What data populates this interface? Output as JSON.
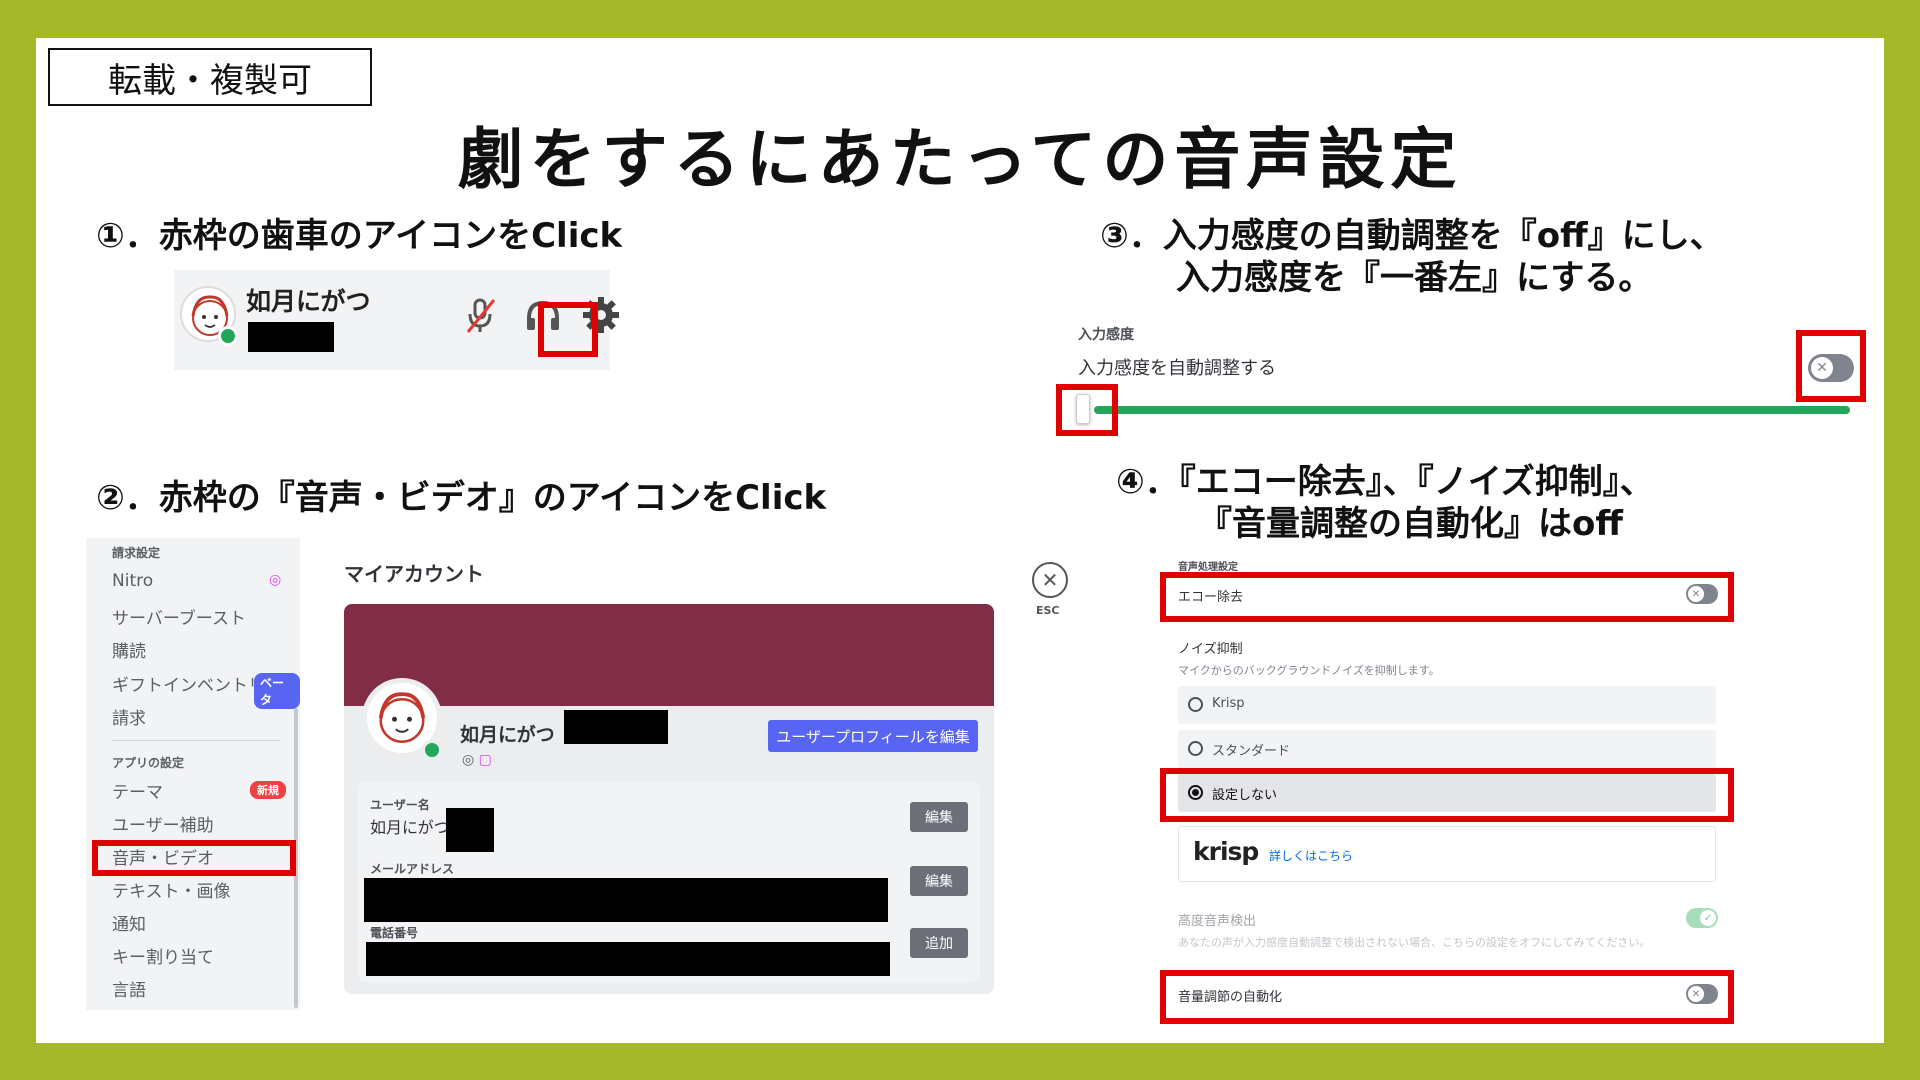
{
  "tag": "転載・複製可",
  "title": "劇をするにあたっての音声設定",
  "step1": {
    "text": "①．赤枠の歯車のアイコンをClick",
    "username": "如月にがつ"
  },
  "step2": {
    "text": "②．赤枠の『音声・ビデオ』のアイコンをClick",
    "sidebar": {
      "section1": "請求設定",
      "items1": [
        "Nitro",
        "サーバーブースト",
        "購読",
        "ギフトインベントリ",
        "請求"
      ],
      "beta": "ベータ",
      "section2": "アプリの設定",
      "items2": [
        "テーマ",
        "ユーザー補助",
        "音声・ビデオ",
        "テキスト・画像",
        "通知",
        "キー割り当て",
        "言語"
      ],
      "new_badge": "新規"
    },
    "account": {
      "heading": "マイアカウント",
      "esc": "ESC",
      "display_name": "如月にがつ",
      "edit_profile": "ユーザープロフィールを編集",
      "username_label": "ユーザー名",
      "username_value": "如月にがつ",
      "email_label": "メールアドレス",
      "phone_label": "電話番号",
      "edit": "編集",
      "add": "追加"
    }
  },
  "step3": {
    "line1": "③．入力感度の自動調整を『off』にし、",
    "line2": "入力感度を『一番左』にする。",
    "section": "入力感度",
    "label": "入力感度を自動調整する",
    "slider_value": 0
  },
  "step4": {
    "line1": "④．『エコー除去』、『ノイズ抑制』、",
    "line2": "『音量調整の自動化』はoff",
    "section": "音声処理設定",
    "echo": "エコー除去",
    "noise_title": "ノイズ抑制",
    "noise_desc": "マイクからのバックグラウンドノイズを抑制します。",
    "options": [
      "Krisp",
      "スタンダード",
      "設定しない"
    ],
    "selected": "設定しない",
    "krisp_logo": "krisp",
    "krisp_link": "詳しくはこちら",
    "advanced": "高度音声検出",
    "advanced_desc": "あなたの声が入力感度自動調整で検出されない場合、こちらの設定をオフにしてみてください。",
    "auto_gain": "音量調節の自動化"
  },
  "colors": {
    "frame": "#a5b829",
    "highlight": "#e00000",
    "online": "#23a55a",
    "blurple": "#5865f2",
    "banner": "#822d46",
    "slider": "#23a55a"
  }
}
